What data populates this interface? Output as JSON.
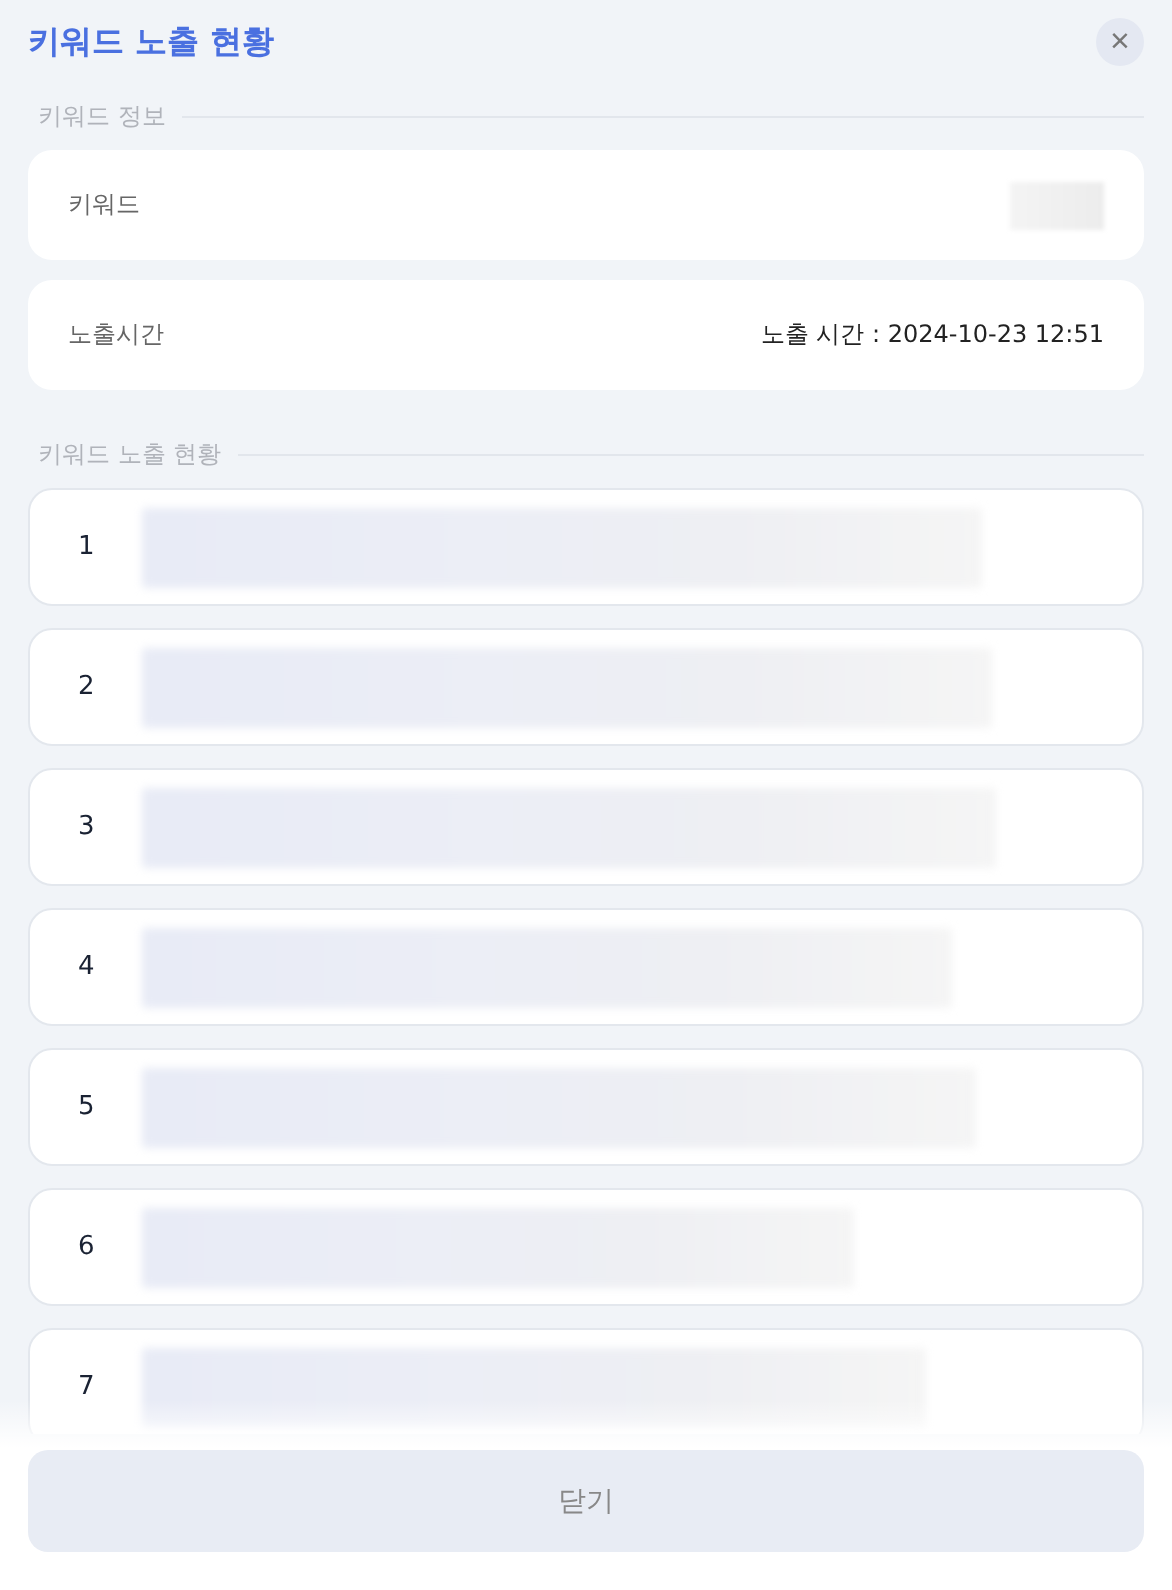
{
  "dialog": {
    "title": "키워드 노출 현황",
    "close_icon": "×"
  },
  "info_section": {
    "heading": "키워드 정보",
    "fields": [
      {
        "kind": "blurred",
        "label": "키워드"
      },
      {
        "kind": "text",
        "label": "노출시간",
        "value": "노출 시간 : 2024-10-23 12:51"
      }
    ]
  },
  "exposure_section": {
    "heading": "키워드 노출 현황",
    "rows": [
      {
        "rank": "1"
      },
      {
        "rank": "2"
      },
      {
        "rank": "3"
      },
      {
        "rank": "4"
      },
      {
        "rank": "5"
      },
      {
        "rank": "6"
      },
      {
        "rank": "7"
      }
    ]
  },
  "footer": {
    "close_button": "닫기"
  }
}
